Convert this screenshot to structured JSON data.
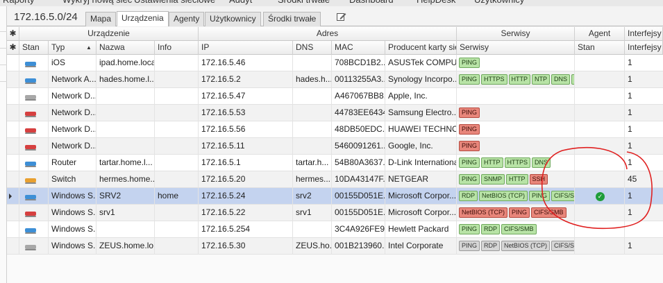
{
  "network": {
    "title": "172.16.5.0/24"
  },
  "topmenu": [
    "Raporty",
    "Wykryj nową sieć",
    "Ustawienia sieciowe",
    "Audyt",
    "Środki trwałe",
    "Dashboard",
    "HelpDesk",
    "Użytkownicy"
  ],
  "tabs": [
    {
      "label": "Mapa",
      "active": false
    },
    {
      "label": "Urządzenia",
      "active": true
    },
    {
      "label": "Agenty",
      "active": false
    },
    {
      "label": "Użytkownicy",
      "active": false
    },
    {
      "label": "Środki trwałe",
      "active": false
    }
  ],
  "header_groups": {
    "device": "Urządzenie",
    "address": "Adres",
    "services": "Serwisy",
    "agent": "Agent",
    "interfaces": "Interfejsy"
  },
  "columns": {
    "status": "Stan",
    "type": "Typ",
    "name": "Nazwa",
    "info": "Info",
    "ip": "IP",
    "dns": "DNS",
    "mac": "MAC",
    "vendor": "Producent karty sie",
    "services": "Serwisy",
    "agent_status": "Stan",
    "interfaces": "Interfejsy"
  },
  "colors": {
    "icon_blue": "#3d8fd6",
    "icon_red": "#d64040",
    "icon_gray": "#a8a8a8",
    "icon_orange": "#e8a030",
    "annotation": "#e02020"
  },
  "rows": [
    {
      "icon": "blue",
      "type": "iOS",
      "name": "ipad.home.local",
      "info": "",
      "ip": "172.16.5.46",
      "dns": "",
      "mac": "708BCD1B2...",
      "vendor": "ASUSTek COMPU...",
      "services": [
        [
          "PING",
          "green"
        ]
      ],
      "agent": false,
      "interfaces": "1"
    },
    {
      "icon": "blue",
      "type": "Network A...",
      "name": "hades.home.l...",
      "info": "",
      "ip": "172.16.5.2",
      "dns": "hades.h...",
      "mac": "00113255A3...",
      "vendor": "Synology Incorpo...",
      "services": [
        [
          "PING",
          "green"
        ],
        [
          "HTTPS",
          "green"
        ],
        [
          "HTTP",
          "green"
        ],
        [
          "NTP",
          "green"
        ],
        [
          "DNS",
          "green"
        ],
        [
          "N",
          "green"
        ]
      ],
      "agent": false,
      "interfaces": "1"
    },
    {
      "icon": "gray",
      "type": "Network D...",
      "name": "",
      "info": "",
      "ip": "172.16.5.47",
      "dns": "",
      "mac": "A467067BB8...",
      "vendor": "Apple, Inc.",
      "services": [],
      "agent": false,
      "interfaces": "1"
    },
    {
      "icon": "red",
      "type": "Network D...",
      "name": "",
      "info": "",
      "ip": "172.16.5.53",
      "dns": "",
      "mac": "44783EE6434F",
      "vendor": "Samsung Electro...",
      "services": [
        [
          "PING",
          "red"
        ]
      ],
      "agent": false,
      "interfaces": "1"
    },
    {
      "icon": "red",
      "type": "Network D...",
      "name": "",
      "info": "",
      "ip": "172.16.5.56",
      "dns": "",
      "mac": "48DB50EDC...",
      "vendor": "HUAWEI TECHNO...",
      "services": [
        [
          "PING",
          "red"
        ]
      ],
      "agent": false,
      "interfaces": "1"
    },
    {
      "icon": "red",
      "type": "Network D...",
      "name": "",
      "info": "",
      "ip": "172.16.5.11",
      "dns": "",
      "mac": "5460091261...",
      "vendor": "Google, Inc.",
      "services": [
        [
          "PING",
          "red"
        ]
      ],
      "agent": false,
      "interfaces": "1"
    },
    {
      "icon": "blue",
      "type": "Router",
      "name": "tartar.home.l...",
      "info": "",
      "ip": "172.16.5.1",
      "dns": "tartar.h...",
      "mac": "54B80A3637...",
      "vendor": "D-Link International",
      "services": [
        [
          "PING",
          "green"
        ],
        [
          "HTTP",
          "green"
        ],
        [
          "HTTPS",
          "green"
        ],
        [
          "DNS",
          "green"
        ]
      ],
      "agent": false,
      "interfaces": "1"
    },
    {
      "icon": "orange",
      "type": "Switch",
      "name": "hermes.home...",
      "info": "",
      "ip": "172.16.5.20",
      "dns": "hermes....",
      "mac": "10DA43147F...",
      "vendor": "NETGEAR",
      "services": [
        [
          "PING",
          "green"
        ],
        [
          "SNMP",
          "green"
        ],
        [
          "HTTP",
          "green"
        ],
        [
          "SSH",
          "red"
        ]
      ],
      "agent": false,
      "interfaces": "45"
    },
    {
      "icon": "blue",
      "type": "Windows S...",
      "name": "SRV2",
      "info": "home",
      "ip": "172.16.5.24",
      "dns": "srv2",
      "mac": "00155D051E...",
      "vendor": "Microsoft Corpor...",
      "services": [
        [
          "RDP",
          "green"
        ],
        [
          "NetBIOS (TCP)",
          "green"
        ],
        [
          "PING",
          "green"
        ],
        [
          "CIFS/SM",
          "green"
        ]
      ],
      "agent": true,
      "interfaces": "1",
      "selected": true
    },
    {
      "icon": "red",
      "type": "Windows S...",
      "name": "srv1",
      "info": "",
      "ip": "172.16.5.22",
      "dns": "srv1",
      "mac": "00155D051E...",
      "vendor": "Microsoft Corpor...",
      "services": [
        [
          "NetBIOS (TCP)",
          "red"
        ],
        [
          "PING",
          "red"
        ],
        [
          "CIFS/SMB",
          "red"
        ]
      ],
      "agent": false,
      "interfaces": "1"
    },
    {
      "icon": "blue",
      "type": "Windows S...",
      "name": "",
      "info": "",
      "ip": "172.16.5.254",
      "dns": "",
      "mac": "3C4A926FE9...",
      "vendor": "Hewlett Packard",
      "services": [
        [
          "PING",
          "green"
        ],
        [
          "RDP",
          "green"
        ],
        [
          "CIFS/SMB",
          "green"
        ]
      ],
      "agent": false,
      "interfaces": ""
    },
    {
      "icon": "gray",
      "type": "Windows S...",
      "name": "ZEUS.home.lo...",
      "info": "",
      "ip": "172.16.5.30",
      "dns": "ZEUS.ho...",
      "mac": "001B213960...",
      "vendor": "Intel Corporate",
      "services": [
        [
          "PING",
          "gray"
        ],
        [
          "RDP",
          "gray"
        ],
        [
          "NetBIOS (TCP)",
          "gray"
        ],
        [
          "CIFS/SI",
          "gray"
        ]
      ],
      "agent": false,
      "interfaces": "1"
    }
  ]
}
